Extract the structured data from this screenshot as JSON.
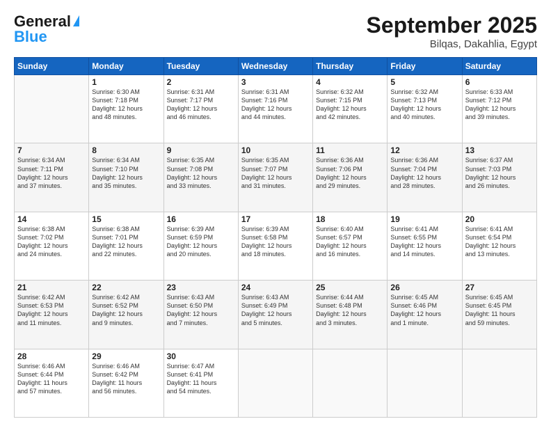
{
  "header": {
    "logo_line1": "General",
    "logo_line2": "Blue",
    "month": "September 2025",
    "location": "Bilqas, Dakahlia, Egypt"
  },
  "weekdays": [
    "Sunday",
    "Monday",
    "Tuesday",
    "Wednesday",
    "Thursday",
    "Friday",
    "Saturday"
  ],
  "weeks": [
    [
      {
        "day": "",
        "info": ""
      },
      {
        "day": "1",
        "info": "Sunrise: 6:30 AM\nSunset: 7:18 PM\nDaylight: 12 hours\nand 48 minutes."
      },
      {
        "day": "2",
        "info": "Sunrise: 6:31 AM\nSunset: 7:17 PM\nDaylight: 12 hours\nand 46 minutes."
      },
      {
        "day": "3",
        "info": "Sunrise: 6:31 AM\nSunset: 7:16 PM\nDaylight: 12 hours\nand 44 minutes."
      },
      {
        "day": "4",
        "info": "Sunrise: 6:32 AM\nSunset: 7:15 PM\nDaylight: 12 hours\nand 42 minutes."
      },
      {
        "day": "5",
        "info": "Sunrise: 6:32 AM\nSunset: 7:13 PM\nDaylight: 12 hours\nand 40 minutes."
      },
      {
        "day": "6",
        "info": "Sunrise: 6:33 AM\nSunset: 7:12 PM\nDaylight: 12 hours\nand 39 minutes."
      }
    ],
    [
      {
        "day": "7",
        "info": "Sunrise: 6:34 AM\nSunset: 7:11 PM\nDaylight: 12 hours\nand 37 minutes."
      },
      {
        "day": "8",
        "info": "Sunrise: 6:34 AM\nSunset: 7:10 PM\nDaylight: 12 hours\nand 35 minutes."
      },
      {
        "day": "9",
        "info": "Sunrise: 6:35 AM\nSunset: 7:08 PM\nDaylight: 12 hours\nand 33 minutes."
      },
      {
        "day": "10",
        "info": "Sunrise: 6:35 AM\nSunset: 7:07 PM\nDaylight: 12 hours\nand 31 minutes."
      },
      {
        "day": "11",
        "info": "Sunrise: 6:36 AM\nSunset: 7:06 PM\nDaylight: 12 hours\nand 29 minutes."
      },
      {
        "day": "12",
        "info": "Sunrise: 6:36 AM\nSunset: 7:04 PM\nDaylight: 12 hours\nand 28 minutes."
      },
      {
        "day": "13",
        "info": "Sunrise: 6:37 AM\nSunset: 7:03 PM\nDaylight: 12 hours\nand 26 minutes."
      }
    ],
    [
      {
        "day": "14",
        "info": "Sunrise: 6:38 AM\nSunset: 7:02 PM\nDaylight: 12 hours\nand 24 minutes."
      },
      {
        "day": "15",
        "info": "Sunrise: 6:38 AM\nSunset: 7:01 PM\nDaylight: 12 hours\nand 22 minutes."
      },
      {
        "day": "16",
        "info": "Sunrise: 6:39 AM\nSunset: 6:59 PM\nDaylight: 12 hours\nand 20 minutes."
      },
      {
        "day": "17",
        "info": "Sunrise: 6:39 AM\nSunset: 6:58 PM\nDaylight: 12 hours\nand 18 minutes."
      },
      {
        "day": "18",
        "info": "Sunrise: 6:40 AM\nSunset: 6:57 PM\nDaylight: 12 hours\nand 16 minutes."
      },
      {
        "day": "19",
        "info": "Sunrise: 6:41 AM\nSunset: 6:55 PM\nDaylight: 12 hours\nand 14 minutes."
      },
      {
        "day": "20",
        "info": "Sunrise: 6:41 AM\nSunset: 6:54 PM\nDaylight: 12 hours\nand 13 minutes."
      }
    ],
    [
      {
        "day": "21",
        "info": "Sunrise: 6:42 AM\nSunset: 6:53 PM\nDaylight: 12 hours\nand 11 minutes."
      },
      {
        "day": "22",
        "info": "Sunrise: 6:42 AM\nSunset: 6:52 PM\nDaylight: 12 hours\nand 9 minutes."
      },
      {
        "day": "23",
        "info": "Sunrise: 6:43 AM\nSunset: 6:50 PM\nDaylight: 12 hours\nand 7 minutes."
      },
      {
        "day": "24",
        "info": "Sunrise: 6:43 AM\nSunset: 6:49 PM\nDaylight: 12 hours\nand 5 minutes."
      },
      {
        "day": "25",
        "info": "Sunrise: 6:44 AM\nSunset: 6:48 PM\nDaylight: 12 hours\nand 3 minutes."
      },
      {
        "day": "26",
        "info": "Sunrise: 6:45 AM\nSunset: 6:46 PM\nDaylight: 12 hours\nand 1 minute."
      },
      {
        "day": "27",
        "info": "Sunrise: 6:45 AM\nSunset: 6:45 PM\nDaylight: 11 hours\nand 59 minutes."
      }
    ],
    [
      {
        "day": "28",
        "info": "Sunrise: 6:46 AM\nSunset: 6:44 PM\nDaylight: 11 hours\nand 57 minutes."
      },
      {
        "day": "29",
        "info": "Sunrise: 6:46 AM\nSunset: 6:42 PM\nDaylight: 11 hours\nand 56 minutes."
      },
      {
        "day": "30",
        "info": "Sunrise: 6:47 AM\nSunset: 6:41 PM\nDaylight: 11 hours\nand 54 minutes."
      },
      {
        "day": "",
        "info": ""
      },
      {
        "day": "",
        "info": ""
      },
      {
        "day": "",
        "info": ""
      },
      {
        "day": "",
        "info": ""
      }
    ]
  ]
}
